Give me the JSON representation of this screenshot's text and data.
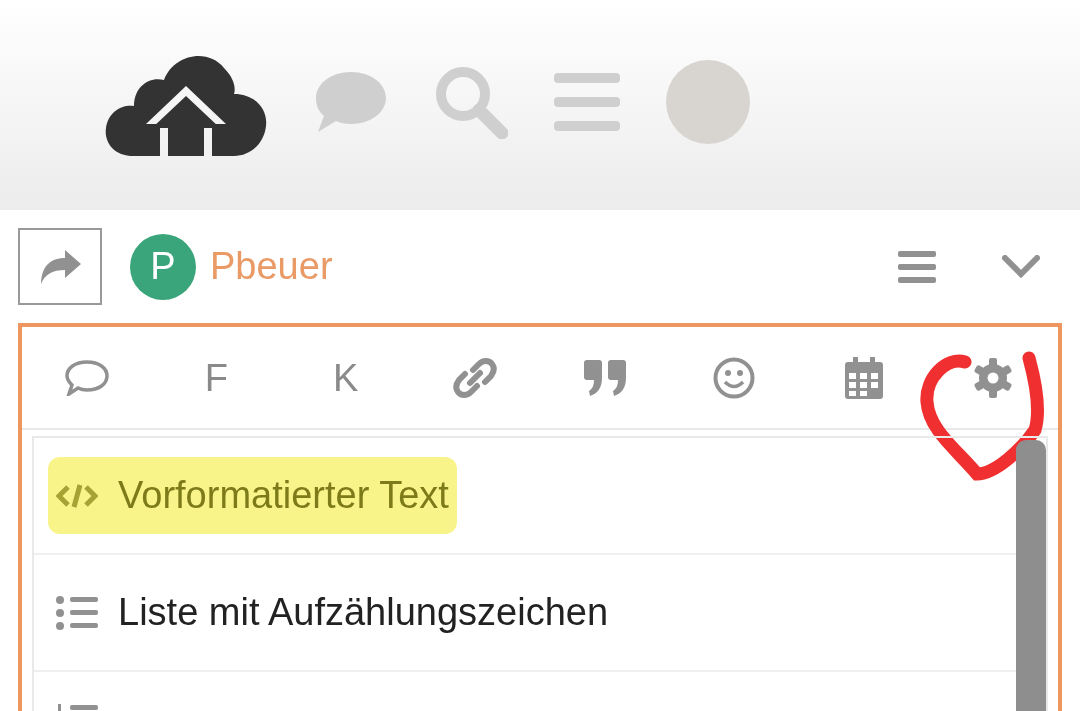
{
  "header": {
    "icons": [
      {
        "kind": "logo"
      },
      {
        "kind": "chat"
      },
      {
        "kind": "search"
      },
      {
        "kind": "menu"
      },
      {
        "kind": "avatar"
      }
    ]
  },
  "composer": {
    "user_initial": "P",
    "username": "Pbeuer"
  },
  "toolbar": [
    {
      "kind": "chat"
    },
    {
      "kind": "text",
      "label": "F"
    },
    {
      "kind": "text",
      "label": "K"
    },
    {
      "kind": "link"
    },
    {
      "kind": "quote"
    },
    {
      "kind": "emoji"
    },
    {
      "kind": "calendar"
    },
    {
      "kind": "gear",
      "circled": true
    }
  ],
  "menu": [
    {
      "kind": "code",
      "label": "Vorformatierter Text",
      "highlighted": true
    },
    {
      "kind": "bullets",
      "label": "Liste mit Aufzählungszeichen",
      "highlighted": false
    },
    {
      "kind": "numbers"
    }
  ]
}
